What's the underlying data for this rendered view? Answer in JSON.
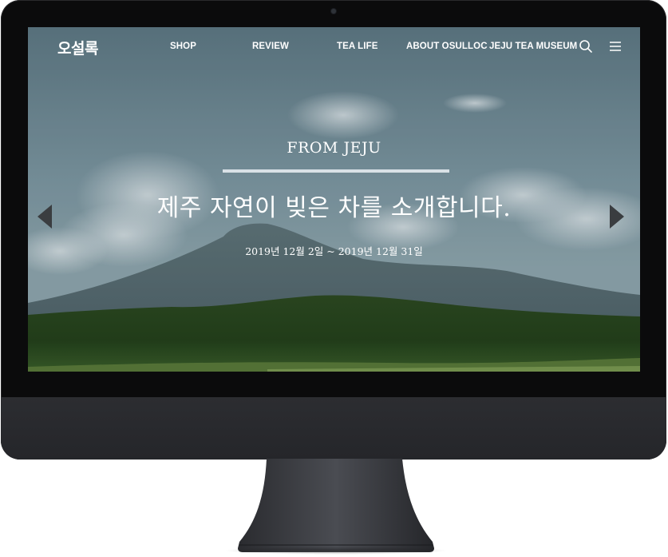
{
  "nav": {
    "logo": "오설록",
    "items": [
      {
        "label": "SHOP"
      },
      {
        "label": "REVIEW"
      },
      {
        "label": "TEA LIFE"
      },
      {
        "label": "ABOUT OSULLOC"
      },
      {
        "label": "JEJU TEA MUSEUM"
      }
    ],
    "icons": {
      "search": "search-icon",
      "menu": "hamburger-menu-icon"
    }
  },
  "hero": {
    "eyebrow": "FROM JEJU",
    "title": "제주 자연이 빚은 차를 소개합니다.",
    "date": "2019년 12월 2일 ~ 2019년 12월 31일",
    "prev_icon": "chevron-left-icon",
    "next_icon": "chevron-right-icon"
  },
  "colors": {
    "bezel": "#0b0b0c",
    "chin": "#2c2d31",
    "sky": "#6f8a96",
    "text": "#ffffff"
  }
}
